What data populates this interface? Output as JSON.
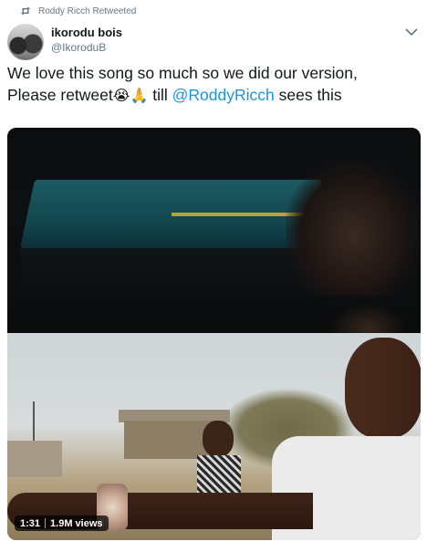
{
  "retweet_context": {
    "text": "Roddy Ricch Retweeted",
    "icon": "retweet-icon"
  },
  "author": {
    "display_name": "ikorodu bois",
    "handle": "@IkoroduB",
    "avatar_icon": "avatar"
  },
  "tweet": {
    "text_line1": "We love this song so much so we did our version,",
    "text_line2_prefix": "Please retweet",
    "emoji_1": "😭",
    "emoji_2": "🙏",
    "text_line2_mid": " till ",
    "mention": "@RoddyRicch",
    "text_line2_suffix": " sees this"
  },
  "video": {
    "duration": "1:31",
    "views": "1.9M views"
  },
  "menu_icon": "chevron-down-icon",
  "colors": {
    "link": "#1b95e0",
    "secondary_text": "#657786",
    "primary_text": "#14171a"
  }
}
